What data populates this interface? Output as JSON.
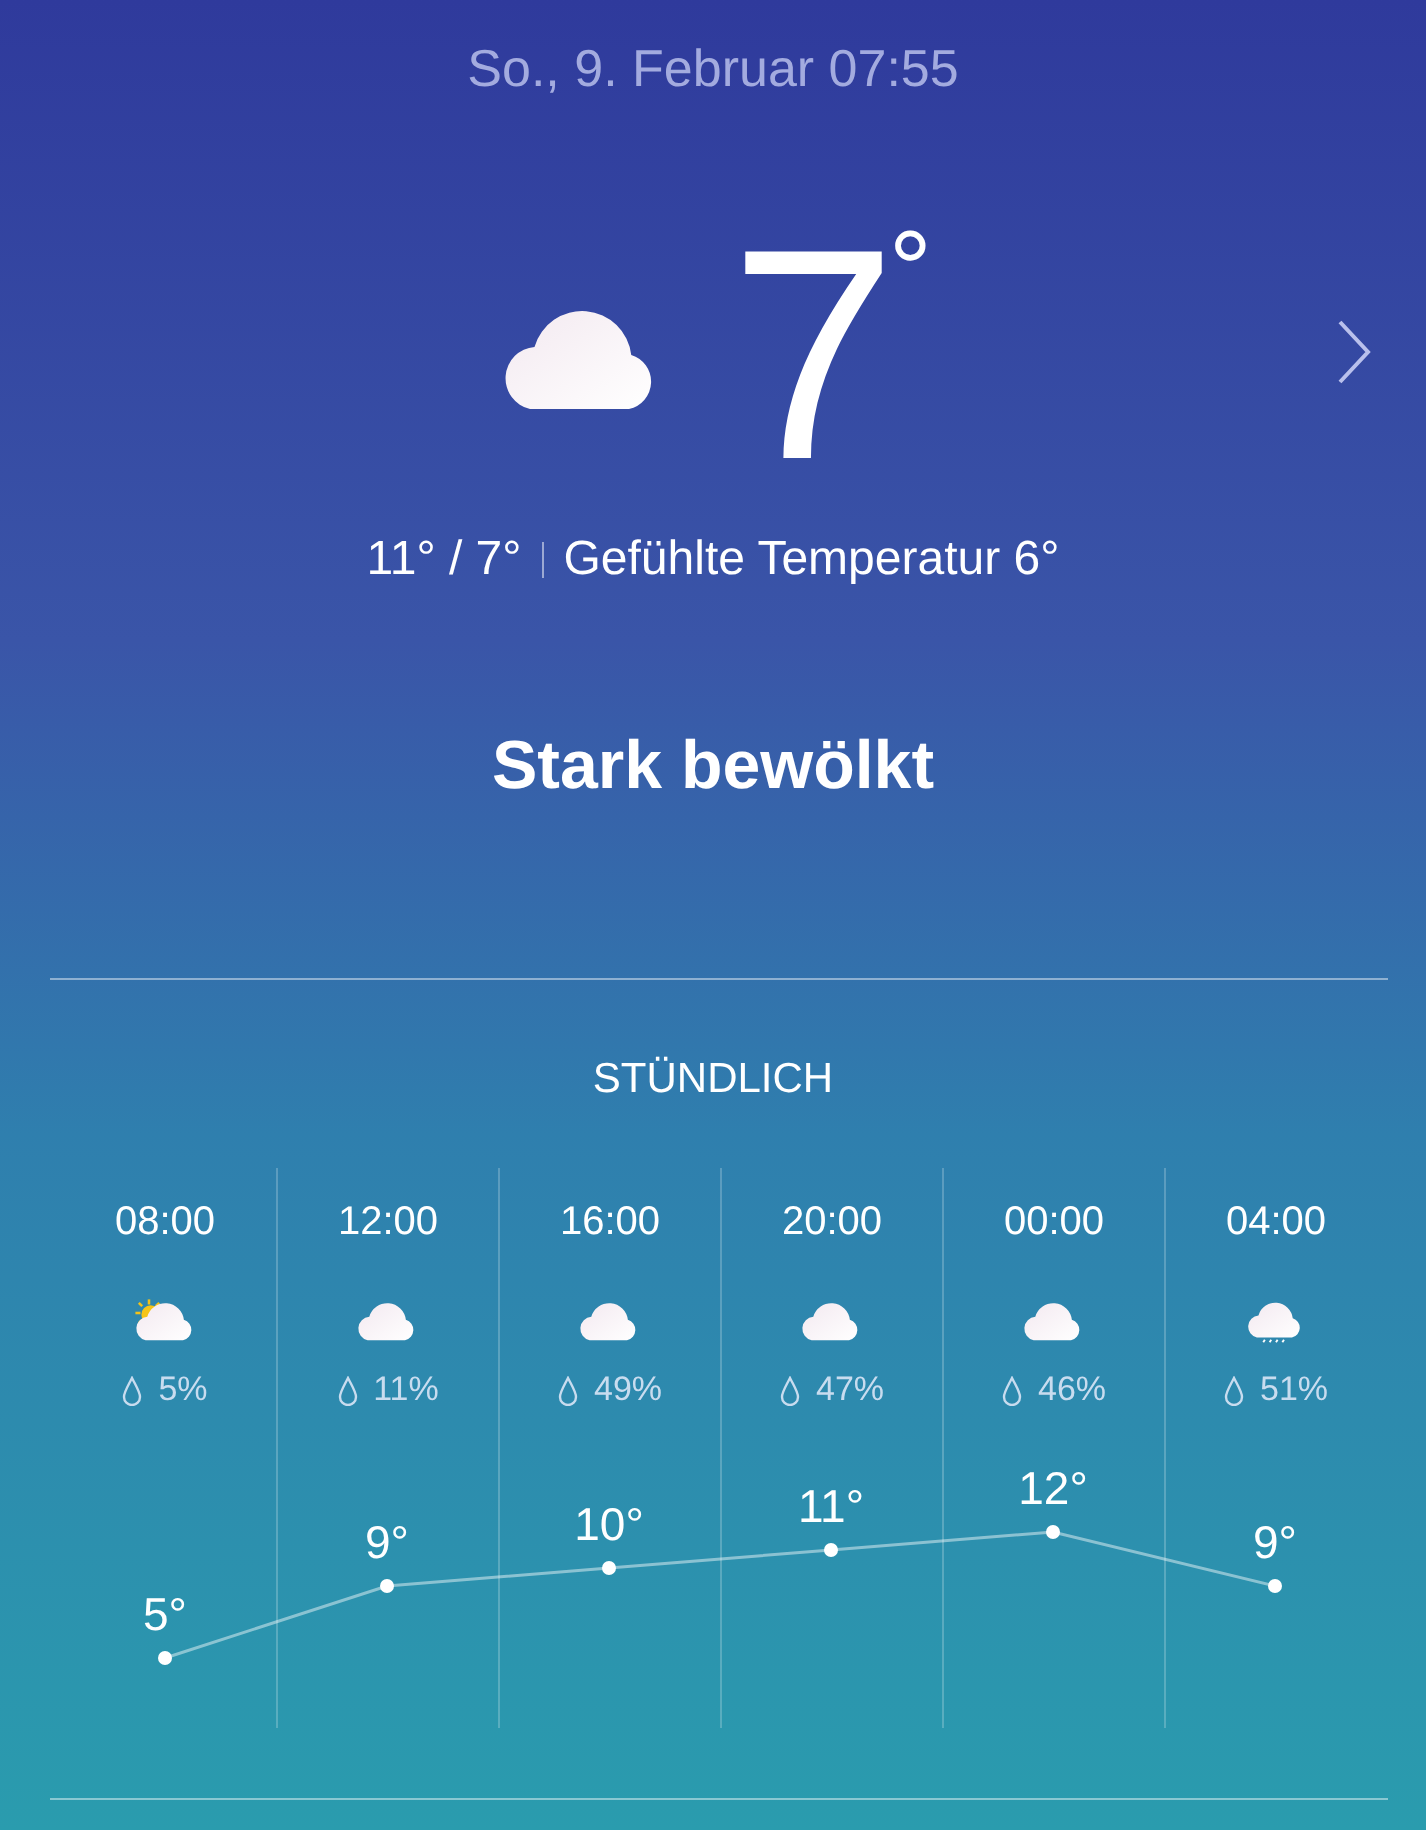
{
  "header": {
    "date": "So., 9. Februar 07:55"
  },
  "current": {
    "kind": "cloudy",
    "temperature": "7",
    "degree": "°",
    "high_low": "11° / 7°",
    "feels_like": "Gefühlte Temperatur 6°",
    "condition": "Stark bewölkt"
  },
  "hourly": {
    "title": "STÜNDLICH",
    "hours": [
      {
        "kind": "partly-sunny",
        "precipitation": "5%"
      },
      {
        "kind": "cloudy",
        "precipitation": "11%"
      },
      {
        "kind": "cloudy",
        "precipitation": "49%"
      },
      {
        "kind": "cloudy",
        "precipitation": "47%"
      },
      {
        "kind": "cloudy",
        "precipitation": "46%"
      },
      {
        "kind": "rain",
        "precipitation": "51%"
      }
    ],
    "chart_data": {
      "type": "line",
      "categories": [
        "08:00",
        "12:00",
        "16:00",
        "20:00",
        "00:00",
        "04:00"
      ],
      "marker": "circle",
      "values": [
        5,
        9,
        10,
        11,
        12,
        9
      ],
      "value_labels": [
        "5°",
        "9°",
        "10°",
        "11°",
        "12°",
        "9°"
      ]
    }
  }
}
